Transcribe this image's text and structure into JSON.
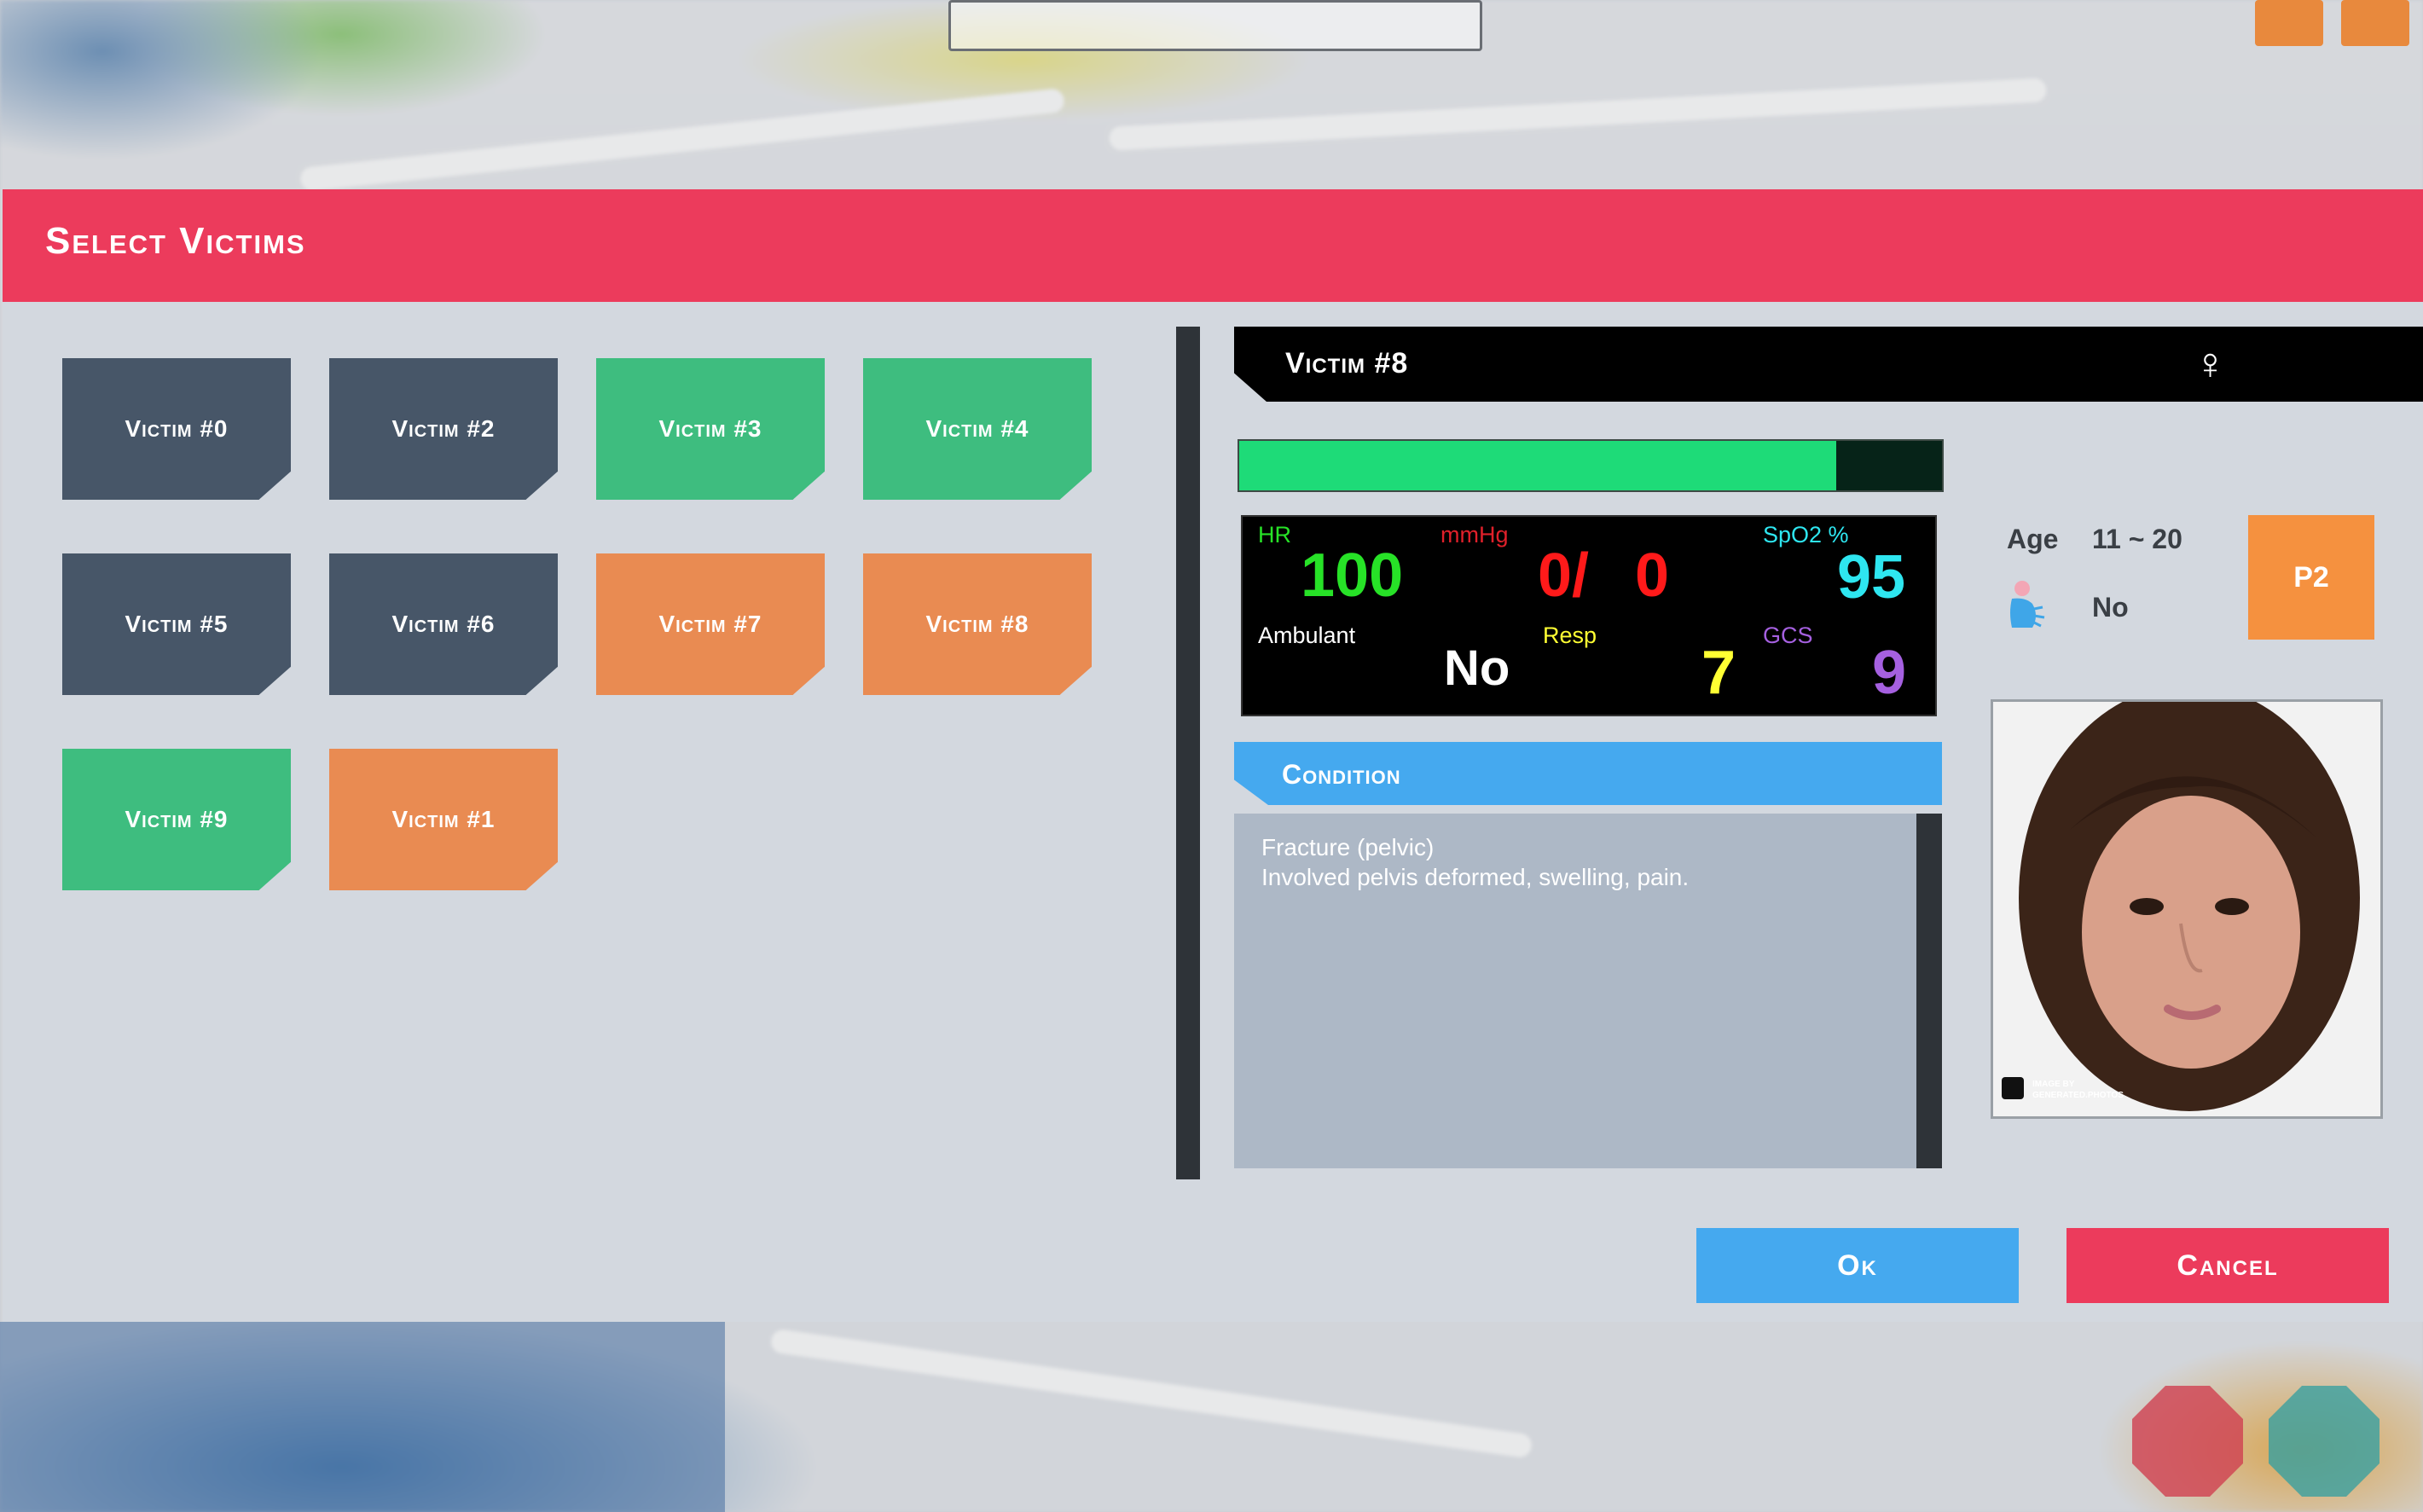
{
  "dialog": {
    "title": "Select Victims"
  },
  "victims": [
    {
      "label": "Victim #0",
      "color": "#475668"
    },
    {
      "label": "Victim #2",
      "color": "#475668"
    },
    {
      "label": "Victim #3",
      "color": "#3ebd7f"
    },
    {
      "label": "Victim #4",
      "color": "#3ebd7f"
    },
    {
      "label": "Victim #5",
      "color": "#475668"
    },
    {
      "label": "Victim #6",
      "color": "#475668"
    },
    {
      "label": "Victim #7",
      "color": "#e98b52"
    },
    {
      "label": "Victim #8",
      "color": "#e98b52"
    },
    {
      "label": "Victim #9",
      "color": "#3ebd7f"
    },
    {
      "label": "Victim #1",
      "color": "#e98b52"
    }
  ],
  "detail": {
    "name": "Victim #8",
    "gender_icon": "female-icon",
    "gender_glyph": "♀",
    "health_fraction": 0.85,
    "vitals": {
      "hr_label": "HR",
      "hr_value": "100",
      "bp_label": "mmHg",
      "bp_systolic": "0/",
      "bp_diastolic": "0",
      "spo2_label": "SpO2 %",
      "spo2_value": "95",
      "ambulant_label": "Ambulant",
      "ambulant_value": "No",
      "resp_label": "Resp",
      "resp_value": "7",
      "gcs_label": "GCS",
      "gcs_value": "9"
    },
    "condition_title": "Condition",
    "condition_text": "Fracture (pelvic)\nInvolved pelvis deformed, swelling, pain.",
    "age_label": "Age",
    "age_value": "11 ~ 20",
    "pregnant_icon": "pregnancy-icon",
    "pregnant_value": "No",
    "priority": "P2",
    "photo_credit_line1": "IMAGE BY",
    "photo_credit_line2": "GENERATED.PHOTOS"
  },
  "buttons": {
    "ok": "Ok",
    "cancel": "Cancel"
  },
  "colors": {
    "header": "#ec3b5c",
    "ok": "#45a9ef",
    "cancel": "#ec3b5c",
    "priority": "#f5913f"
  }
}
